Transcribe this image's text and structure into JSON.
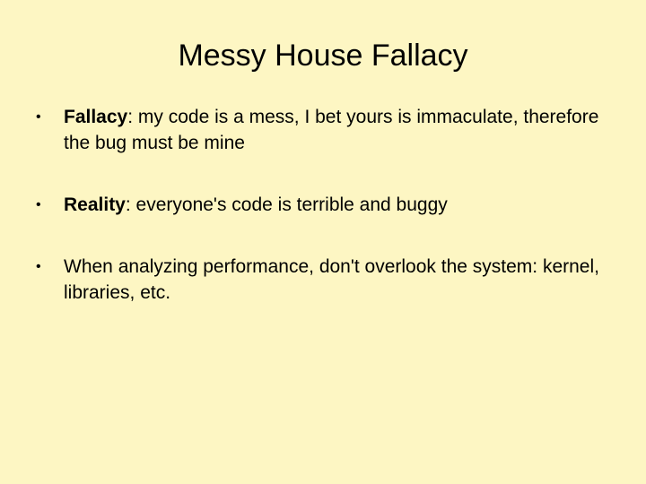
{
  "slide": {
    "title": "Messy House Fallacy",
    "bullets": [
      {
        "term": "Fallacy",
        "text": ": my code is a mess, I bet yours is immaculate, therefore the bug must be mine"
      },
      {
        "term": "Reality",
        "text": ": everyone's code is terrible and buggy"
      },
      {
        "term": "",
        "text": "When analyzing performance, don't overlook the system: kernel, libraries, etc."
      }
    ],
    "bullet_glyph": "•",
    "colors": {
      "background": "#fdf6c3",
      "text": "#000000"
    }
  }
}
